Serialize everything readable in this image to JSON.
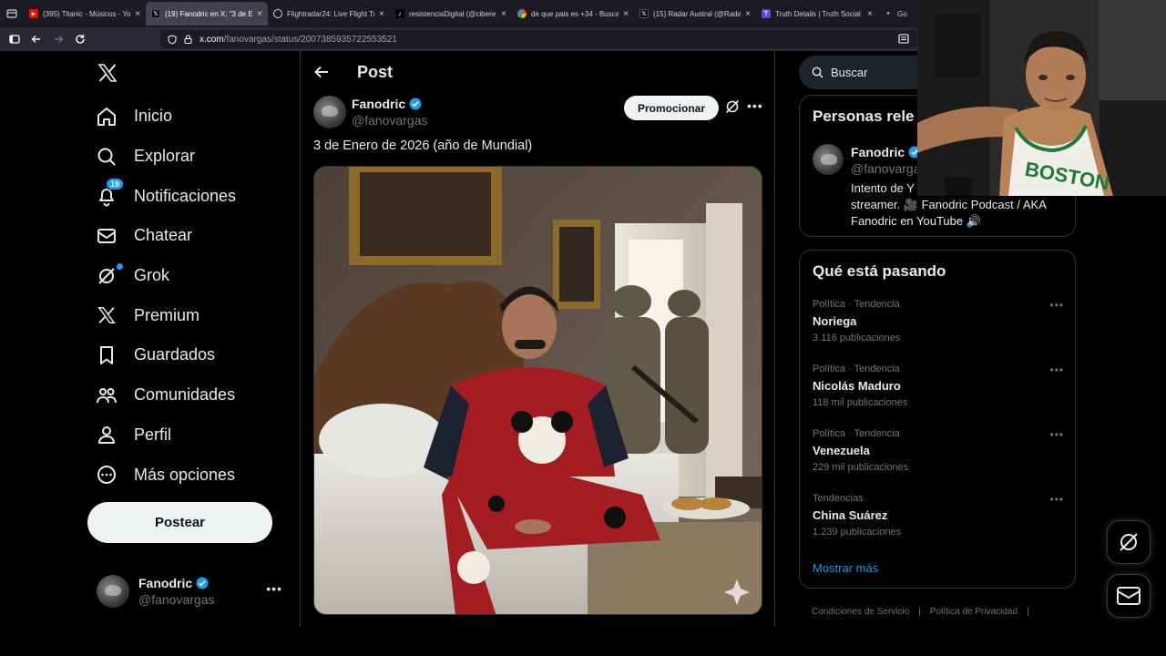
{
  "browser": {
    "tabs": [
      {
        "title": "(395) Titanic - Músicos - Yo",
        "icon": "youtube-icon",
        "color": "#ff0000",
        "active": false
      },
      {
        "title": "(19) Fanodric en X: \"3 de En",
        "icon": "x-icon",
        "color": "#000000",
        "active": true
      },
      {
        "title": "Flightradar24: Live Flight Tr",
        "icon": "flightradar-icon",
        "color": "#f5c518",
        "active": false
      },
      {
        "title": "resistenciaDigital (@cibere",
        "icon": "tiktok-icon",
        "color": "#000000",
        "active": false
      },
      {
        "title": "de que pais es +34 - Buscar",
        "icon": "google-icon",
        "color": "#4285f4",
        "active": false
      },
      {
        "title": "(15) Radar Austral (@Radar",
        "icon": "x-icon",
        "color": "#000000",
        "active": false
      },
      {
        "title": "Truth Details | Truth Social",
        "icon": "truth-social-icon",
        "color": "#5448ee",
        "active": false
      },
      {
        "title": "Go",
        "icon": "gemini-icon",
        "color": "#4285f4",
        "active": false
      }
    ],
    "url_host": "x.com",
    "url_path": "/fanovargas/status/2007385935722553521"
  },
  "sidebar": {
    "items": [
      {
        "label": "Inicio",
        "icon": "home-icon"
      },
      {
        "label": "Explorar",
        "icon": "search-icon"
      },
      {
        "label": "Notificaciones",
        "icon": "bell-icon",
        "badge": "19"
      },
      {
        "label": "Chatear",
        "icon": "mail-icon"
      },
      {
        "label": "Grok",
        "icon": "grok-icon"
      },
      {
        "label": "Premium",
        "icon": "x-icon"
      },
      {
        "label": "Guardados",
        "icon": "bookmark-icon"
      },
      {
        "label": "Comunidades",
        "icon": "communities-icon"
      },
      {
        "label": "Perfil",
        "icon": "person-icon"
      },
      {
        "label": "Más opciones",
        "icon": "more-circle-icon"
      }
    ],
    "post_button": "Postear",
    "account": {
      "name": "Fanodric",
      "handle": "@fanovargas"
    }
  },
  "main": {
    "header": "Post",
    "author": {
      "name": "Fanodric",
      "handle": "@fanovargas"
    },
    "promote_button": "Promocionar",
    "text": "3 de Enero de 2026 (año de Mundial)"
  },
  "right": {
    "search_placeholder": "Buscar",
    "relevant": {
      "title": "Personas rele",
      "name": "Fanodric",
      "handle": "@fanovargas",
      "bio_lines": [
        "Intento de Y",
        "streamer. 🎥 Fanodric Podcast / AKA",
        "Fanodric en YouTube 🔊"
      ]
    },
    "trends_title": "Qué está pasando",
    "trends": [
      {
        "meta": "Política · Tendencia",
        "name": "Noriega",
        "count": "3.116 publicaciones"
      },
      {
        "meta": "Política · Tendencia",
        "name": "Nicolás Maduro",
        "count": "118 mil publicaciones"
      },
      {
        "meta": "Política · Tendencia",
        "name": "Venezuela",
        "count": "229 mil publicaciones"
      },
      {
        "meta": "Tendencias",
        "name": "China Suárez",
        "count": "1.239 publicaciones"
      }
    ],
    "show_more": "Mostrar más",
    "footer": [
      "Condiciones de Servicio",
      "|",
      "Política de Privacidad",
      "|"
    ]
  },
  "overlay": {
    "jersey_text": "BOSTON"
  },
  "colors": {
    "accent": "#1d9bf0",
    "background": "#000000",
    "border": "#2f3336",
    "muted": "#71767b"
  }
}
